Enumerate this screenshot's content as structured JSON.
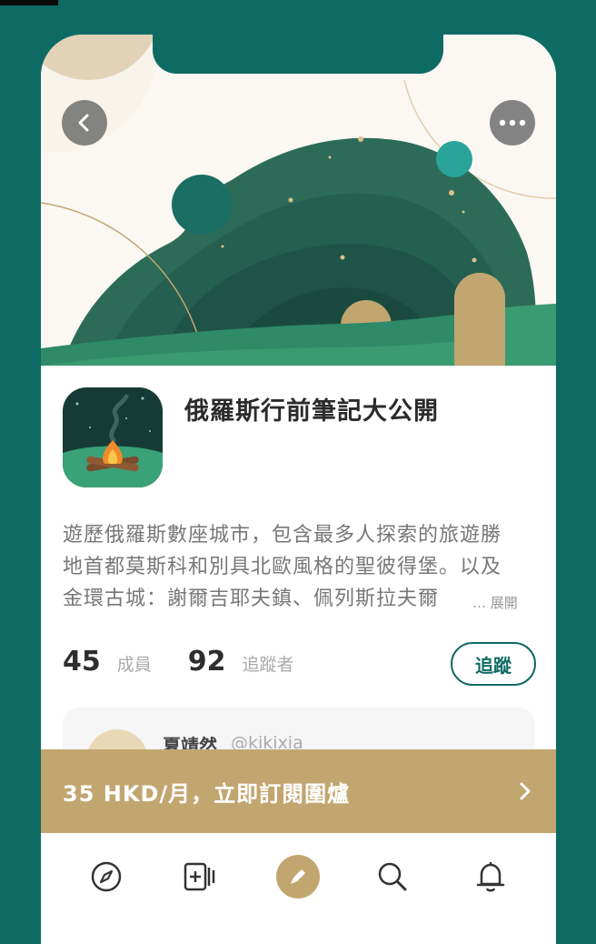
{
  "header": {
    "back_icon": "chevron-left-icon",
    "more_icon": "more-horizontal-icon"
  },
  "group": {
    "title": "俄羅斯行前筆記大公開",
    "description_lines": [
      "遊歷俄羅斯數座城市，包含最多人探索的旅遊勝",
      "地首都莫斯科和別具北歐風格的聖彼得堡。以及",
      "金環古城：謝爾吉耶夫鎮、佩列斯拉夫爾"
    ],
    "expand_label": "… 展開"
  },
  "stats": {
    "members_count": "45",
    "members_label": "成員",
    "followers_count": "92",
    "followers_label": "追蹤者"
  },
  "follow_button": "追蹤",
  "post": {
    "author_name": "夏靖然",
    "author_handle": "@kikixia"
  },
  "subscribe": {
    "label": "35  HKD/月，立即訂閱圍爐",
    "arrow_icon": "chevron-right-icon"
  },
  "tabbar": {
    "items": [
      "compass-icon",
      "add-note-icon",
      "pen-icon",
      "search-icon",
      "bell-icon"
    ]
  },
  "colors": {
    "brand_green": "#0e6b64",
    "gold": "#c2a670",
    "dark_green": "#1f5347"
  }
}
